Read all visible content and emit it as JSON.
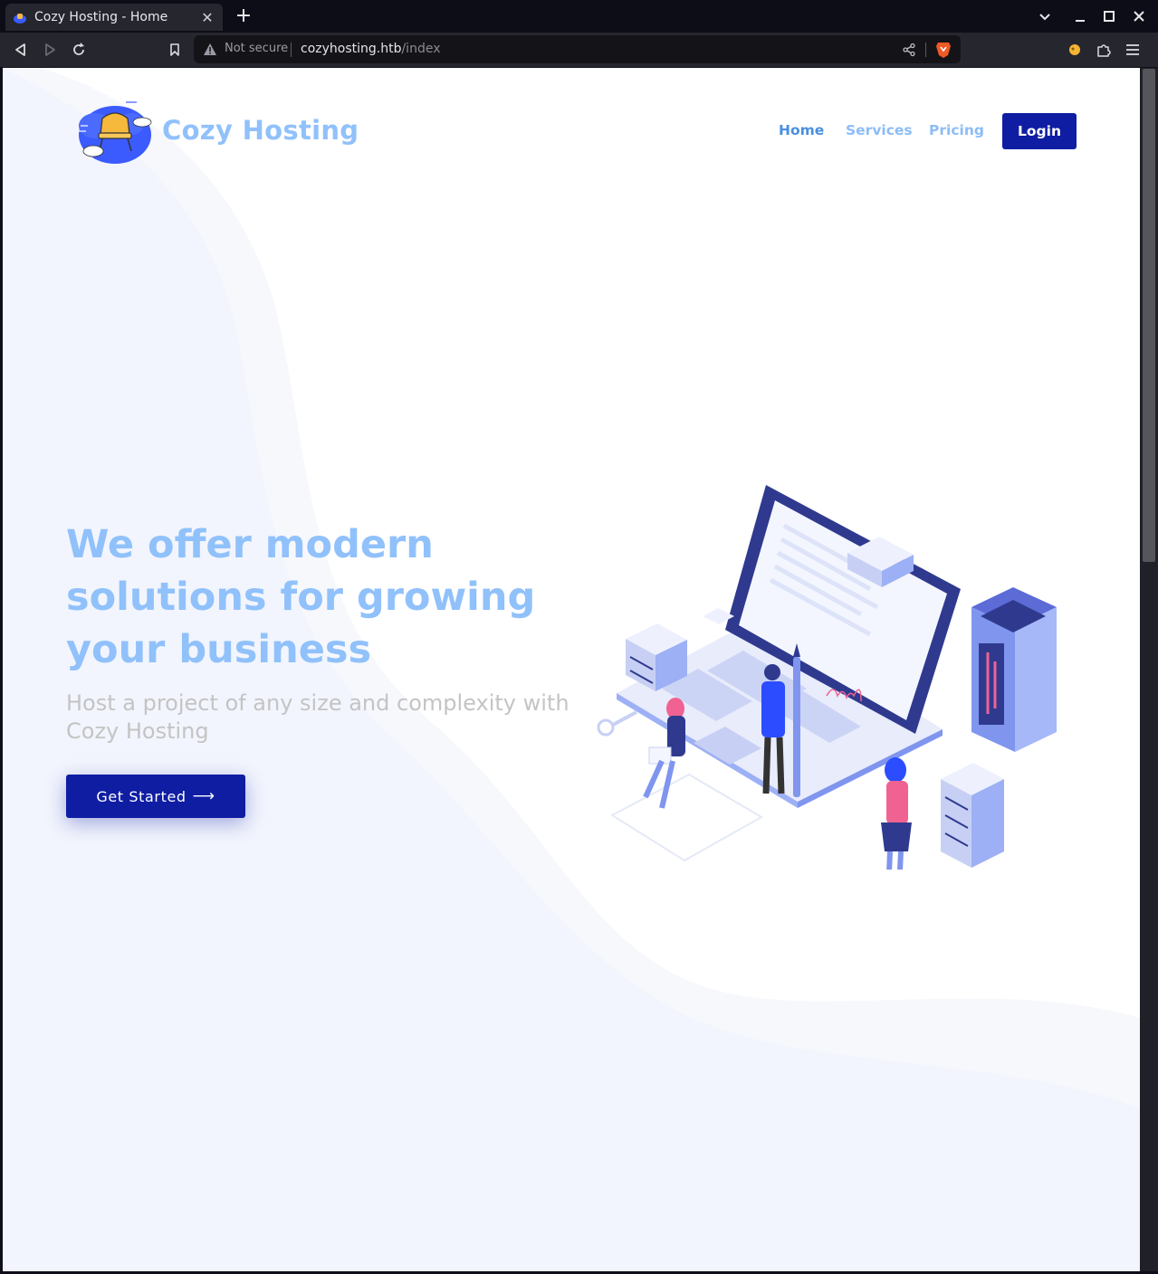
{
  "browser": {
    "tab_title": "Cozy Hosting - Home",
    "tab_close": "✕",
    "new_tab": "+",
    "security_label": "Not secure",
    "url_host": "cozyhosting.htb",
    "url_path": "/index"
  },
  "header": {
    "brand": "Cozy Hosting",
    "nav": {
      "home": "Home",
      "services": "Services",
      "pricing": "Pricing"
    },
    "login": "Login"
  },
  "hero": {
    "title_lines": [
      "We offer modern",
      "solutions for growing",
      "your business"
    ],
    "subtitle_lines": [
      "Host a project of any size and complexity with",
      "Cozy Hosting"
    ],
    "cta": "Get Started",
    "cta_arrow": "⟶"
  },
  "colors": {
    "primary": "#0f1da3",
    "accent_light": "#90c1fb",
    "nav_active": "#4a8fe0",
    "muted_text": "#c4c4c4",
    "wave_bg": "#f2f5fd"
  },
  "icons": [
    "brave-favicon",
    "back-icon",
    "forward-icon",
    "reload-icon",
    "bookmark-icon",
    "warning-icon",
    "share-icon",
    "brave-shield-icon",
    "extension-icon",
    "puzzle-icon",
    "menu-icon",
    "chevron-down-icon",
    "minimize-icon",
    "maximize-icon",
    "close-icon",
    "cozy-hosting-logo",
    "hero-illustration"
  ]
}
